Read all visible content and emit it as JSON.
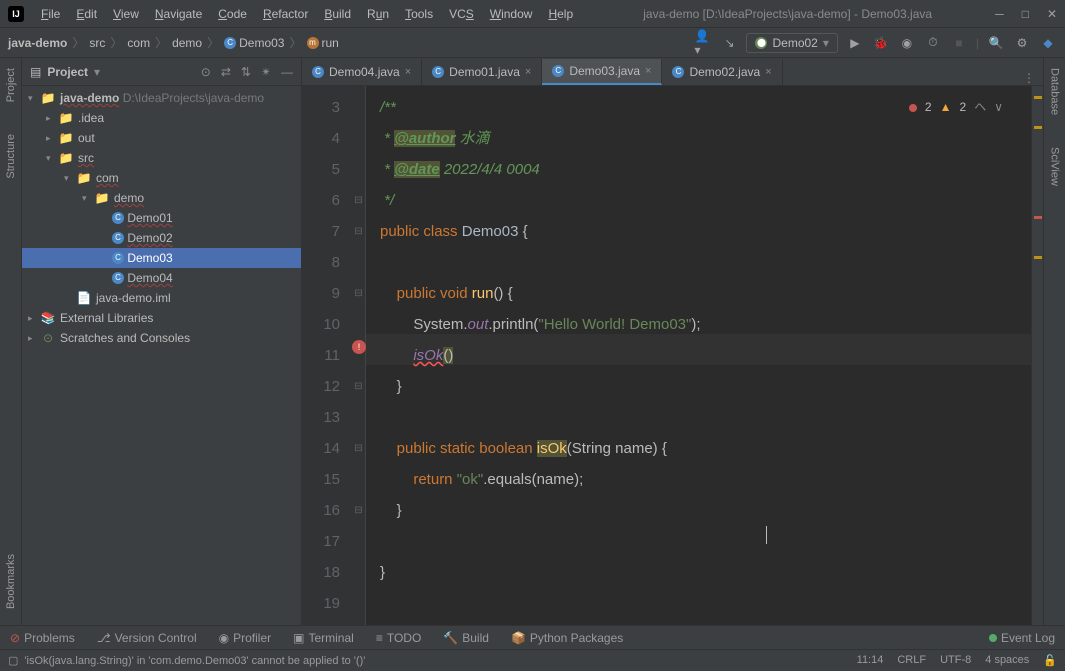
{
  "titlebar": {
    "title": "java-demo [D:\\IdeaProjects\\java-demo] - Demo03.java"
  },
  "menu": {
    "file": "File",
    "edit": "Edit",
    "view": "View",
    "navigate": "Navigate",
    "code": "Code",
    "refactor": "Refactor",
    "build": "Build",
    "run": "Run",
    "tools": "Tools",
    "vcs": "VCS",
    "window": "Window",
    "help": "Help"
  },
  "breadcrumbs": {
    "p0": "java-demo",
    "p1": "src",
    "p2": "com",
    "p3": "demo",
    "p4": "Demo03",
    "p5": "run"
  },
  "run_config": "Demo02",
  "project_panel": {
    "title": "Project",
    "root": "java-demo",
    "root_path": "D:\\IdeaProjects\\java-demo",
    "idea": ".idea",
    "out": "out",
    "src": "src",
    "com": "com",
    "demo": "demo",
    "files": [
      "Demo01",
      "Demo02",
      "Demo03",
      "Demo04"
    ],
    "iml": "java-demo.iml",
    "ext_lib": "External Libraries",
    "scratch": "Scratches and Consoles"
  },
  "tabs": [
    {
      "name": "Demo04.java"
    },
    {
      "name": "Demo01.java"
    },
    {
      "name": "Demo03.java"
    },
    {
      "name": "Demo02.java"
    }
  ],
  "editor": {
    "lines": [
      "3",
      "4",
      "5",
      "6",
      "7",
      "8",
      "9",
      "10",
      "11",
      "12",
      "13",
      "14",
      "15",
      "16",
      "17",
      "18",
      "19"
    ],
    "l3": "/**",
    "l4_tag": "@author",
    "l4_txt": " 水滴",
    "l5_tag": "@date",
    "l5_txt": " 2022/4/4 0004",
    "l6": " */",
    "l7_public": "public",
    "l7_class": "class",
    "l7_name": "Demo03",
    "l7_brace": " {",
    "l9_public": "public",
    "l9_void": "void",
    "l9_run": "run",
    "l9_rest": "() {",
    "l10_sys": "System.",
    "l10_out": "out",
    "l10_print": ".println(",
    "l10_str": "\"Hello World! Demo03\"",
    "l10_end": ");",
    "l11_isok": "isOk",
    "l11_paren": "()",
    "l12": "    }",
    "l14_public": "public",
    "l14_static": "static",
    "l14_boolean": "boolean",
    "l14_isok": "isOk",
    "l14_sig": "(String name) {",
    "l15_return": "return",
    "l15_str": "\"ok\"",
    "l15_rest": ".equals(name);",
    "l16": "    }",
    "l18": "}",
    "errors": "2",
    "warnings": "2"
  },
  "left_tools": {
    "project": "Project",
    "structure": "Structure",
    "bookmarks": "Bookmarks"
  },
  "right_tools": {
    "database": "Database",
    "sciview": "SciView"
  },
  "bottom": {
    "problems": "Problems",
    "vcs": "Version Control",
    "profiler": "Profiler",
    "terminal": "Terminal",
    "todo": "TODO",
    "build": "Build",
    "python": "Python Packages",
    "eventlog": "Event Log"
  },
  "status": {
    "msg": "'isOk(java.lang.String)' in 'com.demo.Demo03' cannot be applied to '()'",
    "pos": "11:14",
    "le": "CRLF",
    "enc": "UTF-8",
    "indent": "4 spaces"
  }
}
